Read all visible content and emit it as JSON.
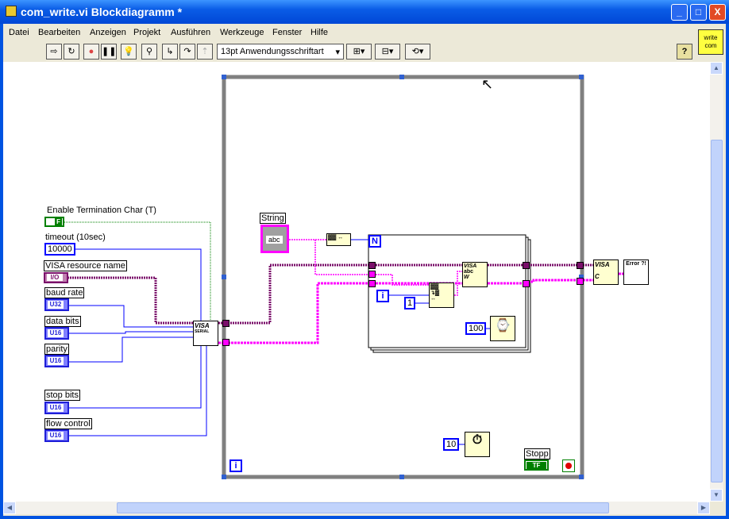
{
  "window": {
    "title": "com_write.vi Blockdiagramm *",
    "buttons": [
      "minimize",
      "maximize",
      "close"
    ]
  },
  "menu": [
    "Datei",
    "Bearbeiten",
    "Anzeigen",
    "Projekt",
    "Ausführen",
    "Werkzeuge",
    "Fenster",
    "Hilfe"
  ],
  "toolbar": {
    "font": "13pt Anwendungsschriftart",
    "tools": [
      "run-arrow-icon",
      "run-continuously-icon",
      "abort-icon",
      "pause-icon",
      "highlight-execution-icon",
      "retain-wire-values-icon",
      "step-into-icon",
      "step-over-icon",
      "step-out-icon"
    ],
    "help": "?"
  },
  "vi_icon": {
    "line1": "write",
    "line2": "com"
  },
  "diagram": {
    "enable_term": {
      "label": "Enable Termination Char (T)",
      "value": "F"
    },
    "timeout": {
      "label": "timeout (10sec)",
      "value": "10000"
    },
    "visa_resource": {
      "label": "VISA resource name",
      "value": "I/O"
    },
    "baud_rate": {
      "label": "baud rate",
      "type": "U32"
    },
    "data_bits": {
      "label": "data bits",
      "type": "U16"
    },
    "parity": {
      "label": "parity",
      "type": "U16"
    },
    "stop_bits": {
      "label": "stop bits",
      "type": "U16"
    },
    "flow_control": {
      "label": "flow control",
      "type": "U16"
    },
    "visa_serial": {
      "line1": "VISA",
      "line2": "SERIAL"
    },
    "string": {
      "label": "String",
      "value": "abc"
    },
    "for_loop": {
      "count": "N",
      "index": "i",
      "subset_length": "1",
      "wait_ms": "100"
    },
    "visa_write": {
      "line1": "VISA",
      "line2": "abc",
      "line3": "W"
    },
    "visa_close": {
      "line1": "VISA",
      "line2": "C"
    },
    "error_handler": {
      "text": "Error ?!"
    },
    "while_loop": {
      "index": "i",
      "wait_ms": "10"
    },
    "stop": {
      "label": "Stopp",
      "value": "TF"
    }
  },
  "colors": {
    "visa_wire": "#7a0f6a",
    "error_wire": "#ff00ff",
    "numeric": "#0000ff",
    "boolean": "#008000",
    "loop_frame": "#808080"
  }
}
